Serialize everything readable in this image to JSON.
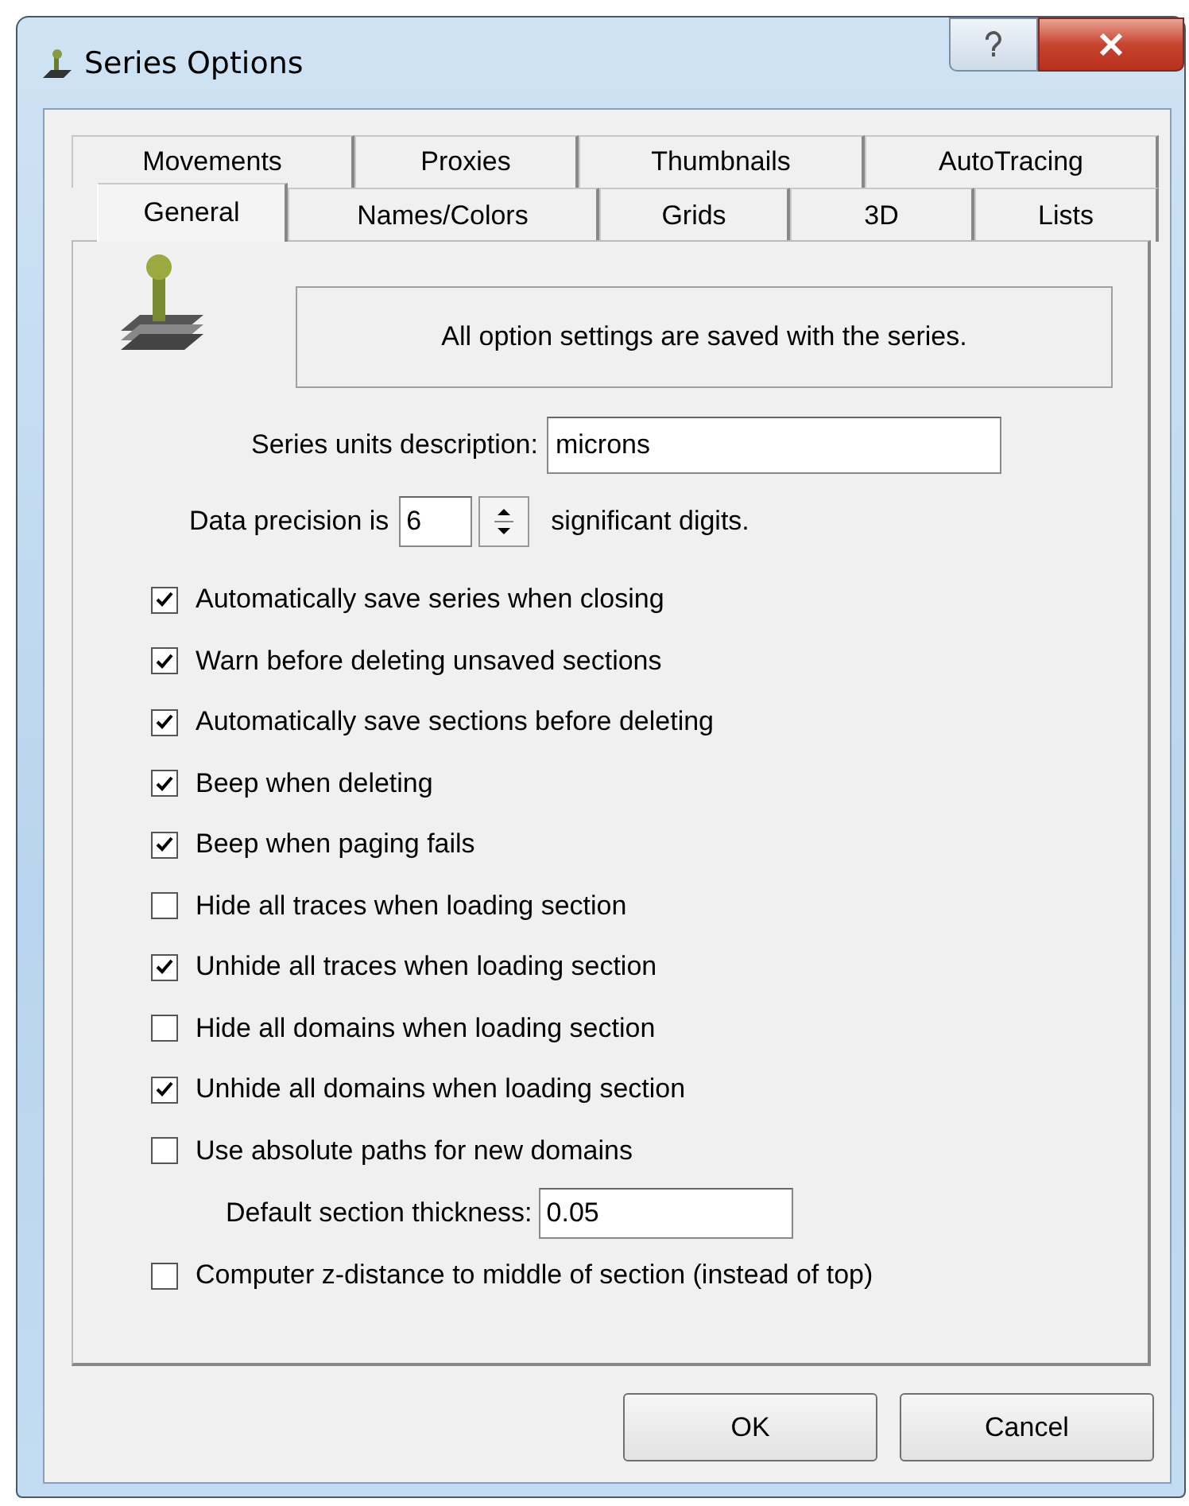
{
  "window": {
    "title": "Series Options"
  },
  "tab_rows": [
    [
      {
        "label": "Movements",
        "selected": false
      },
      {
        "label": "Proxies",
        "selected": false
      },
      {
        "label": "Thumbnails",
        "selected": false
      },
      {
        "label": "AutoTracing",
        "selected": false
      }
    ],
    [
      {
        "label": "General",
        "selected": true
      },
      {
        "label": "Names/Colors",
        "selected": false
      },
      {
        "label": "Grids",
        "selected": false
      },
      {
        "label": "3D",
        "selected": false
      },
      {
        "label": "Lists",
        "selected": false
      }
    ]
  ],
  "info": "All option settings are saved with the series.",
  "units": {
    "label": "Series units description:",
    "value": "microns"
  },
  "precision": {
    "label": "Data precision is",
    "value": "6",
    "suffix": "significant digits."
  },
  "options": [
    {
      "kind": "checkbox",
      "label": "Automatically save series when closing",
      "checked": true
    },
    {
      "kind": "checkbox",
      "label": "Warn before deleting unsaved sections",
      "checked": true
    },
    {
      "kind": "checkbox",
      "label": "Automatically save sections before deleting",
      "checked": true
    },
    {
      "kind": "checkbox",
      "label": "Beep when deleting",
      "checked": true
    },
    {
      "kind": "checkbox",
      "label": "Beep when paging fails",
      "checked": true
    },
    {
      "kind": "checkbox",
      "label": "Hide all traces when loading section",
      "checked": false
    },
    {
      "kind": "checkbox",
      "label": "Unhide all traces when loading section",
      "checked": true
    },
    {
      "kind": "checkbox",
      "label": "Hide all domains when loading section",
      "checked": false
    },
    {
      "kind": "checkbox",
      "label": "Unhide all domains when loading section",
      "checked": true
    },
    {
      "kind": "checkbox",
      "label": "Use absolute paths for new domains",
      "checked": false
    },
    {
      "kind": "field",
      "label": "Default section thickness:",
      "value": "0.05"
    },
    {
      "kind": "checkbox",
      "label": "Computer z-distance to middle of section (instead of top)",
      "checked": false
    }
  ],
  "buttons": [
    "OK",
    "Cancel"
  ]
}
